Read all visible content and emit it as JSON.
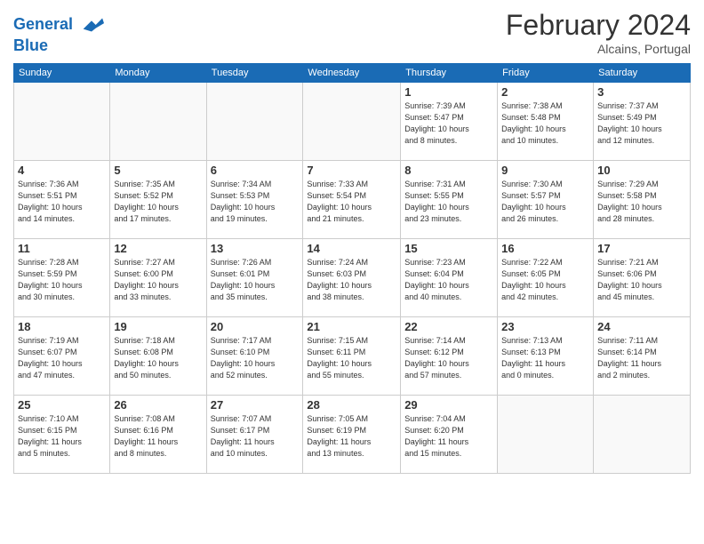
{
  "logo": {
    "line1": "General",
    "line2": "Blue"
  },
  "title": "February 2024",
  "location": "Alcains, Portugal",
  "days_of_week": [
    "Sunday",
    "Monday",
    "Tuesday",
    "Wednesday",
    "Thursday",
    "Friday",
    "Saturday"
  ],
  "weeks": [
    [
      {
        "day": "",
        "info": ""
      },
      {
        "day": "",
        "info": ""
      },
      {
        "day": "",
        "info": ""
      },
      {
        "day": "",
        "info": ""
      },
      {
        "day": "1",
        "info": "Sunrise: 7:39 AM\nSunset: 5:47 PM\nDaylight: 10 hours\nand 8 minutes."
      },
      {
        "day": "2",
        "info": "Sunrise: 7:38 AM\nSunset: 5:48 PM\nDaylight: 10 hours\nand 10 minutes."
      },
      {
        "day": "3",
        "info": "Sunrise: 7:37 AM\nSunset: 5:49 PM\nDaylight: 10 hours\nand 12 minutes."
      }
    ],
    [
      {
        "day": "4",
        "info": "Sunrise: 7:36 AM\nSunset: 5:51 PM\nDaylight: 10 hours\nand 14 minutes."
      },
      {
        "day": "5",
        "info": "Sunrise: 7:35 AM\nSunset: 5:52 PM\nDaylight: 10 hours\nand 17 minutes."
      },
      {
        "day": "6",
        "info": "Sunrise: 7:34 AM\nSunset: 5:53 PM\nDaylight: 10 hours\nand 19 minutes."
      },
      {
        "day": "7",
        "info": "Sunrise: 7:33 AM\nSunset: 5:54 PM\nDaylight: 10 hours\nand 21 minutes."
      },
      {
        "day": "8",
        "info": "Sunrise: 7:31 AM\nSunset: 5:55 PM\nDaylight: 10 hours\nand 23 minutes."
      },
      {
        "day": "9",
        "info": "Sunrise: 7:30 AM\nSunset: 5:57 PM\nDaylight: 10 hours\nand 26 minutes."
      },
      {
        "day": "10",
        "info": "Sunrise: 7:29 AM\nSunset: 5:58 PM\nDaylight: 10 hours\nand 28 minutes."
      }
    ],
    [
      {
        "day": "11",
        "info": "Sunrise: 7:28 AM\nSunset: 5:59 PM\nDaylight: 10 hours\nand 30 minutes."
      },
      {
        "day": "12",
        "info": "Sunrise: 7:27 AM\nSunset: 6:00 PM\nDaylight: 10 hours\nand 33 minutes."
      },
      {
        "day": "13",
        "info": "Sunrise: 7:26 AM\nSunset: 6:01 PM\nDaylight: 10 hours\nand 35 minutes."
      },
      {
        "day": "14",
        "info": "Sunrise: 7:24 AM\nSunset: 6:03 PM\nDaylight: 10 hours\nand 38 minutes."
      },
      {
        "day": "15",
        "info": "Sunrise: 7:23 AM\nSunset: 6:04 PM\nDaylight: 10 hours\nand 40 minutes."
      },
      {
        "day": "16",
        "info": "Sunrise: 7:22 AM\nSunset: 6:05 PM\nDaylight: 10 hours\nand 42 minutes."
      },
      {
        "day": "17",
        "info": "Sunrise: 7:21 AM\nSunset: 6:06 PM\nDaylight: 10 hours\nand 45 minutes."
      }
    ],
    [
      {
        "day": "18",
        "info": "Sunrise: 7:19 AM\nSunset: 6:07 PM\nDaylight: 10 hours\nand 47 minutes."
      },
      {
        "day": "19",
        "info": "Sunrise: 7:18 AM\nSunset: 6:08 PM\nDaylight: 10 hours\nand 50 minutes."
      },
      {
        "day": "20",
        "info": "Sunrise: 7:17 AM\nSunset: 6:10 PM\nDaylight: 10 hours\nand 52 minutes."
      },
      {
        "day": "21",
        "info": "Sunrise: 7:15 AM\nSunset: 6:11 PM\nDaylight: 10 hours\nand 55 minutes."
      },
      {
        "day": "22",
        "info": "Sunrise: 7:14 AM\nSunset: 6:12 PM\nDaylight: 10 hours\nand 57 minutes."
      },
      {
        "day": "23",
        "info": "Sunrise: 7:13 AM\nSunset: 6:13 PM\nDaylight: 11 hours\nand 0 minutes."
      },
      {
        "day": "24",
        "info": "Sunrise: 7:11 AM\nSunset: 6:14 PM\nDaylight: 11 hours\nand 2 minutes."
      }
    ],
    [
      {
        "day": "25",
        "info": "Sunrise: 7:10 AM\nSunset: 6:15 PM\nDaylight: 11 hours\nand 5 minutes."
      },
      {
        "day": "26",
        "info": "Sunrise: 7:08 AM\nSunset: 6:16 PM\nDaylight: 11 hours\nand 8 minutes."
      },
      {
        "day": "27",
        "info": "Sunrise: 7:07 AM\nSunset: 6:17 PM\nDaylight: 11 hours\nand 10 minutes."
      },
      {
        "day": "28",
        "info": "Sunrise: 7:05 AM\nSunset: 6:19 PM\nDaylight: 11 hours\nand 13 minutes."
      },
      {
        "day": "29",
        "info": "Sunrise: 7:04 AM\nSunset: 6:20 PM\nDaylight: 11 hours\nand 15 minutes."
      },
      {
        "day": "",
        "info": ""
      },
      {
        "day": "",
        "info": ""
      }
    ]
  ]
}
